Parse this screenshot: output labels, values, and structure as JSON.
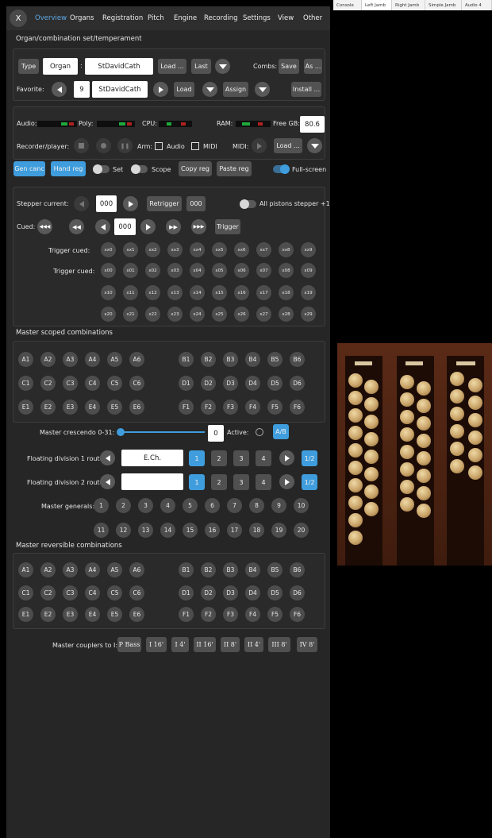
{
  "nav": {
    "close_label": "X",
    "tabs": [
      "Overview",
      "Organs",
      "Registration",
      "Pitch",
      "Engine",
      "Recording",
      "Settings",
      "View",
      "Other"
    ],
    "active_tab": "Overview"
  },
  "organ": {
    "section_title": "Organ/combination set/temperament",
    "type_label": "Type",
    "type_value": "Organ",
    "separator": ":",
    "organ_name": "StDavidCath",
    "load_label": "Load ...",
    "last_label": "Last",
    "combs_label": "Combs:",
    "save_label": "Save",
    "as_label": "As ...",
    "favorite_label": "Favorite:",
    "favorite_number": "9",
    "favorite_name": "StDavidCath",
    "fav_load_label": "Load",
    "assign_label": "Assign",
    "install_label": "Install ..."
  },
  "status": {
    "audio_label": "Audio:",
    "poly_label": "Poly:",
    "cpu_label": "CPU:",
    "ram_label": "RAM:",
    "freegb_label": "Free GB:",
    "freegb_value": "80.6",
    "recorder_label": "Recorder/player:",
    "arm_label": "Arm:",
    "audio_chk_label": "Audio",
    "midi_chk_label": "MIDI",
    "midi_label": "MIDI:",
    "load_label": "Load ..."
  },
  "reg": {
    "gen_canc_label": "Gen canc",
    "hand_reg_label": "Hand reg",
    "set_label": "Set",
    "scope_label": "Scope",
    "copy_reg_label": "Copy reg",
    "paste_reg_label": "Paste reg",
    "fullscreen_label": "Full-screen"
  },
  "stepper": {
    "current_label": "Stepper current:",
    "current_value": "000",
    "retrigger_label": "Retrigger",
    "retrigger_value": "000",
    "all_pistons_label": "All pistons stepper +1",
    "cued_label": "Cued:",
    "cued_value": "000",
    "trigger_label": "Trigger",
    "trigger_cued_label": "Trigger cued:",
    "row1": [
      "xx0",
      "xx1",
      "xx2",
      "xx3",
      "xx4",
      "xx5",
      "xx6",
      "xx7",
      "xx8",
      "xx9"
    ],
    "row2": [
      "x00",
      "x01",
      "x02",
      "x03",
      "x04",
      "x05",
      "x06",
      "x07",
      "x08",
      "x09"
    ],
    "row3": [
      "x10",
      "x11",
      "x12",
      "x13",
      "x14",
      "x15",
      "x16",
      "x17",
      "x18",
      "x19"
    ],
    "row4": [
      "x20",
      "x21",
      "x22",
      "x23",
      "x24",
      "x25",
      "x26",
      "x27",
      "x28",
      "x29"
    ]
  },
  "scoped": {
    "title": "Master scoped combinations",
    "left": [
      [
        "A1",
        "A2",
        "A3",
        "A4",
        "A5",
        "A6"
      ],
      [
        "C1",
        "C2",
        "C3",
        "C4",
        "C5",
        "C6"
      ],
      [
        "E1",
        "E2",
        "E3",
        "E4",
        "E5",
        "E6"
      ]
    ],
    "right": [
      [
        "B1",
        "B2",
        "B3",
        "B4",
        "B5",
        "B6"
      ],
      [
        "D1",
        "D2",
        "D3",
        "D4",
        "D5",
        "D6"
      ],
      [
        "F1",
        "F2",
        "F3",
        "F4",
        "F5",
        "F6"
      ]
    ]
  },
  "crescendo": {
    "label": "Master crescendo 0-31:",
    "value": "0",
    "level": 0,
    "active_label": "Active:",
    "ab_label": "A/B"
  },
  "floating": {
    "div1_label": "Floating division 1 route:",
    "div1_value": "E.Ch.",
    "div2_label": "Floating division 2 route:",
    "div2_value": "",
    "nums": [
      "1",
      "2",
      "3",
      "4"
    ],
    "half_label": "1/2"
  },
  "generals": {
    "label": "Master generals:",
    "row1": [
      "1",
      "2",
      "3",
      "4",
      "5",
      "6",
      "7",
      "8",
      "9",
      "10"
    ],
    "row2": [
      "11",
      "12",
      "13",
      "14",
      "15",
      "16",
      "17",
      "18",
      "19",
      "20"
    ]
  },
  "reversible": {
    "title": "Master reversible combinations",
    "left": [
      [
        "A1",
        "A2",
        "A3",
        "A4",
        "A5",
        "A6"
      ],
      [
        "C1",
        "C2",
        "C3",
        "C4",
        "C5",
        "C6"
      ],
      [
        "E1",
        "E2",
        "E3",
        "E4",
        "E5",
        "E6"
      ]
    ],
    "right": [
      [
        "B1",
        "B2",
        "B3",
        "B4",
        "B5",
        "B6"
      ],
      [
        "D1",
        "D2",
        "D3",
        "D4",
        "D5",
        "D6"
      ],
      [
        "F1",
        "F2",
        "F3",
        "F4",
        "F5",
        "F6"
      ]
    ]
  },
  "couplers": {
    "label": "Master couplers to I:",
    "items": [
      "P Bass",
      "I 16'",
      "I 4'",
      "II 16'",
      "II 8'",
      "II 4'",
      "III 8'",
      "IV 8'"
    ]
  },
  "right_tabs": [
    "Console",
    "Left Jamb",
    "Right Jamb",
    "Simple Jamb",
    "Audio 4"
  ],
  "right_active_tab": "Left Jamb",
  "colors": {
    "accent": "#3f9ddd",
    "panel": "#262626",
    "meter_green": "#1faa3a",
    "meter_red": "#b02020"
  }
}
